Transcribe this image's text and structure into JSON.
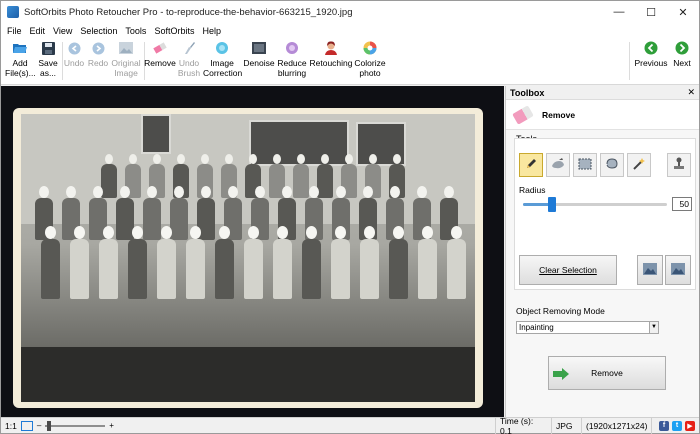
{
  "window": {
    "title": "SoftOrbits Photo Retoucher Pro - to-reproduce-the-behavior-663215_1920.jpg",
    "minimize": "—",
    "maximize": "☐",
    "close": "✕"
  },
  "menu": [
    "File",
    "Edit",
    "View",
    "Selection",
    "Tools",
    "SoftOrbits",
    "Help"
  ],
  "ribbon": {
    "add_files": "Add File(s)...",
    "save_as": "Save as...",
    "undo": "Undo",
    "redo": "Redo",
    "original_image": "Original Image",
    "remove": "Remove",
    "undo_brush": "Undo Brush",
    "image_correction": "Image Correction",
    "denoise": "Denoise",
    "reduce_blurring": "Reduce blurring",
    "retouching": "Retouching",
    "colorize_photo": "Colorize photo",
    "previous": "Previous",
    "next": "Next"
  },
  "toolbox": {
    "title": "Toolbox",
    "close": "✕",
    "mode_name": "Remove",
    "tools_label": "Tools",
    "radius_label": "Radius",
    "radius_value": "50",
    "radius_fraction": 0.2,
    "clear_selection": "Clear Selection",
    "object_removing_mode_label": "Object Removing Mode",
    "object_removing_mode_value": "Inpainting",
    "remove_button": "Remove"
  },
  "status": {
    "zoom_label": "1:1",
    "time": "Time (s): 0.1",
    "format": "JPG",
    "dimensions": "(1920x1271x24)"
  },
  "colors": {
    "accent_blue": "#1e7ad6",
    "active_tool": "#f9e79f",
    "next_green": "#2f9e3a"
  }
}
